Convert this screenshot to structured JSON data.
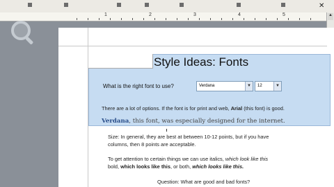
{
  "document": {
    "title": "Style Ideas: Fonts",
    "question_font": "What is the right font to use?",
    "font_value": "Verdana",
    "size_value": "12",
    "options_pre": "There are a lot of options.  If the font is for print and web, ",
    "options_bold": "Arial",
    "options_post": " (this font) is good.",
    "verdana_bold": "Verdana",
    "verdana_rest": ", this font, was especially designed for the internet.",
    "size_line1": "Size: In general, they are best at between 10-12 points, but if you have",
    "size_line2": "columns, then 8 points are acceptable.",
    "attn_pre": "To get attention to certain things we can use italics, ",
    "attn_italic": "which look like this",
    "attn_line2_pre": "bold, ",
    "attn_bold": "which looks like this",
    "attn_mid": ", or both, ",
    "attn_both": "which looks like this.",
    "question_bottom": "Question: What are good and bad fonts?"
  },
  "ruler": {
    "numbers": [
      "1",
      "2",
      "3",
      "4",
      "5"
    ]
  },
  "icons": [
    "magnifier-icon",
    "dropdown-arrow-icon",
    "scroll-up-icon",
    "window-close-icon"
  ]
}
